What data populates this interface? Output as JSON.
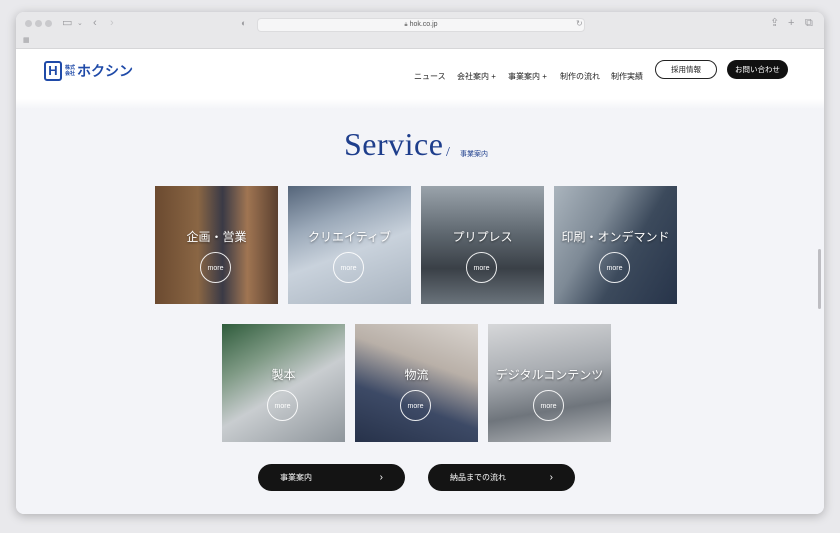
{
  "browser": {
    "url": "hok.co.jp"
  },
  "logo": {
    "mark": "H",
    "small": "株式会社",
    "name": "ホクシン"
  },
  "nav": {
    "items": [
      "ニュース",
      "会社案内 +",
      "事業案内 +",
      "制作の流れ",
      "制作実績"
    ],
    "recruit_label": "採用情報",
    "contact_label": "お問い合わせ"
  },
  "section": {
    "title": "Service",
    "subtitle": "事業案内"
  },
  "tiles": [
    {
      "label": "企画・営業",
      "more": "more"
    },
    {
      "label": "クリエイティブ",
      "more": "more"
    },
    {
      "label": "プリプレス",
      "more": "more"
    },
    {
      "label": "印刷・オンデマンド",
      "more": "more"
    },
    {
      "label": "製本",
      "more": "more"
    },
    {
      "label": "物流",
      "more": "more"
    },
    {
      "label": "デジタルコンテンツ",
      "more": "more"
    }
  ],
  "buttons": {
    "business": "事業案内",
    "flow": "納品までの流れ",
    "arrow": "›"
  }
}
